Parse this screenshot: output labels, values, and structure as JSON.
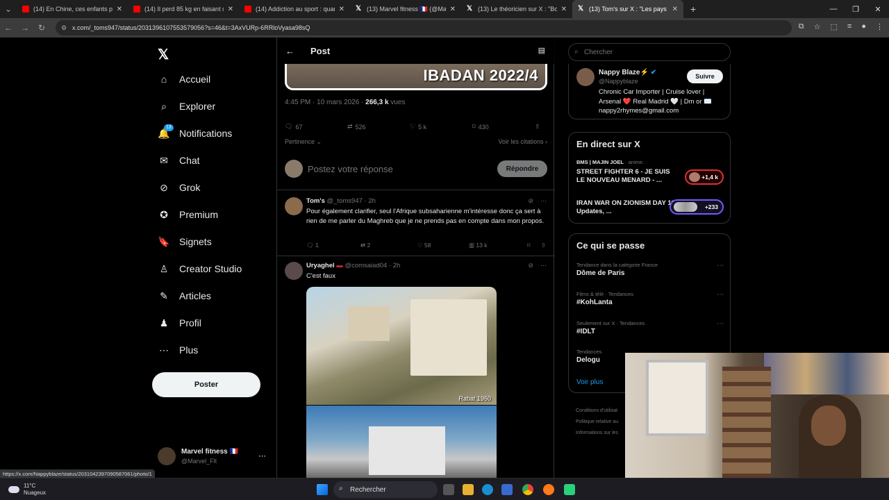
{
  "browser": {
    "tabs": [
      {
        "label": "(14) En Chine, ces enfants porte",
        "kind": "yt"
      },
      {
        "label": "(14) Il perd 85 kg en faisant de",
        "kind": "yt"
      },
      {
        "label": "(14) Addiction au sport : quand",
        "kind": "yt"
      },
      {
        "label": "(13) Marvel fitness 🇫🇷 (@Marve",
        "kind": "x"
      },
      {
        "label": "(13) Le théoricien sur X : \"Bool",
        "kind": "x"
      },
      {
        "label": "(13) Tom's sur X : \"Les pays afri",
        "kind": "x"
      }
    ],
    "url": "x.com/_toms947/status/2031396107553579056?s=46&t=3AxVURp-6RRloVyasa98sQ",
    "status_url": "https://x.com/Nappyblaze/status/2031042397090587061/photo/1"
  },
  "nav": {
    "items": [
      {
        "label": "Accueil",
        "icon": "home-icon",
        "glyph": "⌂"
      },
      {
        "label": "Explorer",
        "icon": "search-icon",
        "glyph": "⌕"
      },
      {
        "label": "Notifications",
        "icon": "bell-icon",
        "glyph": "🔔"
      },
      {
        "label": "Chat",
        "icon": "mail-icon",
        "glyph": "✉"
      },
      {
        "label": "Grok",
        "icon": "grok-icon",
        "glyph": "⊘"
      },
      {
        "label": "Premium",
        "icon": "premium-icon",
        "glyph": "✪"
      },
      {
        "label": "Signets",
        "icon": "bookmark-icon",
        "glyph": "🔖"
      },
      {
        "label": "Creator Studio",
        "icon": "creator-icon",
        "glyph": "♙"
      },
      {
        "label": "Articles",
        "icon": "articles-icon",
        "glyph": "✎"
      },
      {
        "label": "Profil",
        "icon": "profile-icon",
        "glyph": "♟"
      },
      {
        "label": "Plus",
        "icon": "more-icon",
        "glyph": "⋯"
      }
    ],
    "notif_badge": "13",
    "post_button": "Poster",
    "account": {
      "name": "Marvel fitness 🇫🇷",
      "handle": "@Marvel_Flt"
    }
  },
  "main": {
    "title": "Post",
    "image_caption": "IBADAN 2022/4",
    "meta_time": "4:45 PM · 10 mars 2026 · ",
    "meta_views": "266,3 k",
    "meta_views_label": " vues",
    "stats": {
      "replies": "67",
      "reposts": "526",
      "likes": "5 k",
      "bookmarks": "430"
    },
    "sort_label": "Pertinence",
    "quotes_label": "Voir les citations",
    "reply_placeholder": "Postez votre réponse",
    "reply_button": "Répondre",
    "tweets": [
      {
        "name": "Tom's",
        "handle": "@_toms947 · 2h",
        "text": "Pour également clarifier, seul l'Afrique subsaharienne m'intéresse donc ça sert à rien de me parler du Maghreb que je ne prends pas en compte dans mon propos.",
        "replies": "1",
        "reposts": "2",
        "likes": "58",
        "views": "13 k"
      },
      {
        "name": "Uryaghel",
        "handle": "@comsaiad04 · 2h",
        "text": "C'est faux",
        "photo_caption": "Rabat 1960"
      }
    ]
  },
  "right": {
    "search_placeholder": "Chercher",
    "profile": {
      "name": "Nappy Blaze⚡",
      "handle": "@Nappyblaze",
      "bio": "Chronic Car Importer | Cruise lover | Arsenal ❤️ Real Madrid 🤍 | Dm or ✉️ nappy2rhymes@gmail.com",
      "follow": "Suivre"
    },
    "live": {
      "title": "En direct sur X",
      "items": [
        {
          "source": "BMS | MAJIN JOEL",
          "source_suffix": " · anime.",
          "title": "STREET FIGHTER 6 - JE SUIS LE NOUVEAU MENARD - ...",
          "count": "+1,4 k"
        },
        {
          "source": "",
          "source_suffix": "",
          "title": "IRAN WAR ON ZIONISM DAY 11, Updates, ...",
          "count": "+233"
        }
      ]
    },
    "trends": {
      "title": "Ce qui se passe",
      "items": [
        {
          "context": "Tendance dans la catégorie France",
          "name": "Dôme de Paris"
        },
        {
          "context": "Films & télé · Tendances",
          "name": "#KohLanta"
        },
        {
          "context": "Seulement sur X · Tendances",
          "name": "#IDLT"
        },
        {
          "context": "Tendances",
          "name": "Delogu"
        }
      ],
      "see_more": "Voir plus"
    },
    "footer": [
      "Conditions d'utilisat",
      "Politique relative au",
      "Informations sur les"
    ]
  },
  "taskbar": {
    "temp": "11°C",
    "weather": "Nuageux",
    "search": "Rechercher"
  }
}
